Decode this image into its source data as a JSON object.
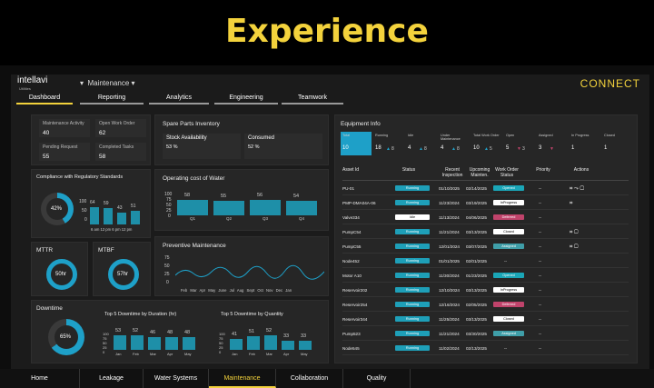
{
  "banner": {
    "title": "Experience"
  },
  "header": {
    "brand": "intellavi",
    "brand_sub": "Utilities",
    "module": "Maintenance",
    "connect": "CONNECT"
  },
  "tabs": [
    "Dashboard",
    "Reporting",
    "Analytics",
    "Engineering",
    "Teamwork"
  ],
  "kpis": [
    {
      "label": "Maintenance Activity",
      "value": "40"
    },
    {
      "label": "Open Work Order",
      "value": "62"
    },
    {
      "label": "Pending Request",
      "value": "55"
    },
    {
      "label": "Completed Tasks",
      "value": "58"
    }
  ],
  "compliance": {
    "title": "Compliance with Regulatory Standards",
    "percent": "42%",
    "ticks": [
      "100",
      "50",
      "0"
    ],
    "values": [
      "64",
      "59",
      "43",
      "51"
    ],
    "xlabels": [
      "6 am",
      "12 pm",
      "6 pm",
      "12 pm"
    ],
    "fraction": 0.42
  },
  "spare": {
    "title": "Spare Parts Inventory",
    "avail_label": "Stock Availability",
    "avail_value": "53 %",
    "consumed_label": "Consumed",
    "consumed_value": "52 %"
  },
  "water": {
    "title": "Operating cost of Water",
    "ticks": [
      "100",
      "75",
      "50",
      "25",
      "0"
    ],
    "categories": [
      "Q1",
      "Q2",
      "Q3",
      "Q4"
    ],
    "values": [
      58,
      55,
      56,
      54
    ],
    "labels": [
      "58",
      "55",
      "56",
      "54"
    ]
  },
  "mttr": {
    "title": "MTTR",
    "value": "50hr"
  },
  "mtbf": {
    "title": "MTBF",
    "value": "57hr"
  },
  "preventive": {
    "title": "Preventive Maintenance",
    "ticks": [
      "75",
      "50",
      "25",
      "0"
    ],
    "months": [
      "Feb",
      "Mar",
      "Apr",
      "May",
      "June",
      "Jul",
      "Aug",
      "Sept",
      "Oct",
      "Nov",
      "Dec",
      "Jan"
    ]
  },
  "downtime": {
    "title": "Downtime",
    "percent": "65%",
    "fraction": 0.65,
    "dur_title": "Top 5 Downtime by Duration (hr)",
    "dur_values": [
      53,
      52,
      46,
      48,
      48
    ],
    "dur_labels": [
      "53",
      "52",
      "46",
      "48",
      "48"
    ],
    "qty_title": "Top 5 Downtime by Quantity",
    "qty_values": [
      41,
      51,
      52,
      33,
      33
    ],
    "qty_labels": [
      "41",
      "51",
      "52",
      "33",
      "33"
    ],
    "ticks": [
      "100",
      "75",
      "50",
      "25",
      "0"
    ],
    "months": [
      "Jan",
      "Feb",
      "Mar",
      "Apr",
      "May"
    ]
  },
  "equipment": {
    "title": "Equipment Info",
    "stats": [
      {
        "label": "Total",
        "value": "10"
      },
      {
        "label": "Running",
        "value": "18",
        "arrow": "▲",
        "sub": "8"
      },
      {
        "label": "Idle",
        "value": "4",
        "arrow": "▲",
        "sub": "8"
      },
      {
        "label": "Under Maintenance",
        "value": "4",
        "arrow": "▲",
        "sub": "8"
      },
      {
        "label": "Total Work Order",
        "value": "10",
        "arrow": "▲",
        "sub": "5"
      },
      {
        "label": "Open",
        "value": "5",
        "arrow": "▼",
        "sub": "3"
      },
      {
        "label": "Assigned",
        "value": "3",
        "arrow": "▼",
        "sub": ""
      },
      {
        "label": "In Progress",
        "value": "1",
        "arrow": "",
        "sub": ""
      },
      {
        "label": "Closed",
        "value": "1",
        "arrow": "",
        "sub": ""
      }
    ],
    "headers": [
      "Asset Id",
      "Status",
      "Recent Inspection",
      "Upcoming Mainten.",
      "Work Order Status",
      "Priority",
      "Actions"
    ],
    "rows": [
      [
        "PU-01",
        "Running",
        "01/10/2025",
        "02/14/2025",
        "Opened",
        "--"
      ],
      [
        "PMP-DMA04A-06",
        "Running",
        "11/23/2024",
        "03/19/2025",
        "InProgress",
        "--"
      ],
      [
        "Valve334",
        "Idle",
        "11/13/2024",
        "04/06/2025",
        "Deferred",
        "--"
      ],
      [
        "PumpC54",
        "Running",
        "11/21/2024",
        "03/13/2025",
        "Closed",
        "--"
      ],
      [
        "PumpC55",
        "Running",
        "12/01/2024",
        "03/07/2025",
        "Assigned",
        "--"
      ],
      [
        "Node452",
        "Running",
        "01/01/2025",
        "02/01/2025",
        "--",
        "--"
      ],
      [
        "Motor A10",
        "Running",
        "11/30/2024",
        "01/23/2025",
        "Opened",
        "--"
      ],
      [
        "Reservoir202",
        "Running",
        "12/10/2024",
        "03/13/2025",
        "InProgress",
        "--"
      ],
      [
        "Reservoir254",
        "Running",
        "12/16/2024",
        "02/05/2025",
        "Deferred",
        "--"
      ],
      [
        "Reservoir344",
        "Running",
        "11/25/2024",
        "03/13/2025",
        "Closed",
        "--"
      ],
      [
        "Pump523",
        "Running",
        "11/21/2024",
        "03/30/2025",
        "Assigned",
        "--"
      ],
      [
        "Node545",
        "Running",
        "11/02/2024",
        "02/13/2025",
        "--",
        "--"
      ]
    ]
  },
  "nav": [
    "Home",
    "Leakage",
    "Water Systems",
    "Maintenance",
    "Collaboration",
    "Quality"
  ],
  "colors": {
    "accent": "#f3d23c",
    "teal": "#1e8fa8",
    "running": "#1e9fb8",
    "deferred": "#c0436b",
    "opened": "#1aa6b7",
    "assigned": "#3f9ea8"
  }
}
